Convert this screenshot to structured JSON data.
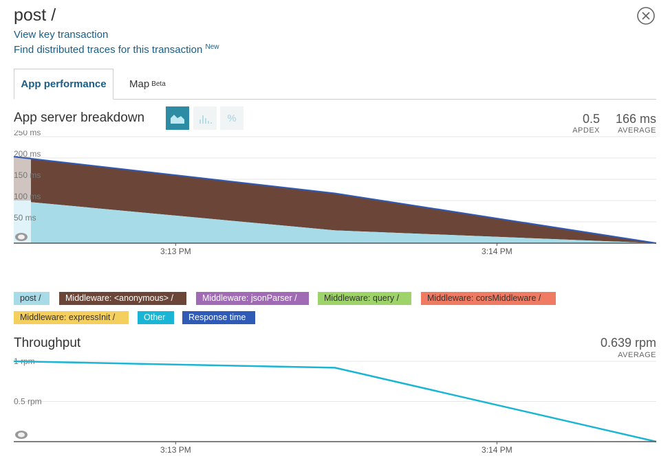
{
  "header": {
    "title": "post /",
    "view_key_transaction": "View key transaction",
    "find_traces": "Find distributed traces for this transaction",
    "find_traces_badge": "New"
  },
  "tabs": [
    {
      "label": "App performance",
      "badge": "",
      "active": true
    },
    {
      "label": "Map",
      "badge": "Beta",
      "active": false
    }
  ],
  "breakdown": {
    "title": "App server breakdown",
    "view_buttons": [
      "area-chart-icon",
      "histogram-icon",
      "percent-icon"
    ],
    "percent_symbol": "%",
    "apdex_value": "0.5",
    "apdex_label": "APDEX",
    "average_value": "166 ms",
    "average_label": "AVERAGE"
  },
  "throughput": {
    "title": "Throughput",
    "average_value": "0.639 rpm",
    "average_label": "AVERAGE"
  },
  "legend": [
    {
      "label": "post /",
      "color": "#a8dbe8",
      "text_color": "#333"
    },
    {
      "label": "Middleware: <anonymous> /",
      "color": "#6b4638",
      "text_color": "#fff"
    },
    {
      "label": "Middleware: jsonParser /",
      "color": "#a06ab4",
      "text_color": "#fff"
    },
    {
      "label": "Middleware: query /",
      "color": "#9ed36a",
      "text_color": "#333"
    },
    {
      "label": "Middleware: corsMiddleware /",
      "color": "#ee7b62",
      "text_color": "#333"
    },
    {
      "label": "Middleware: expressInit /",
      "color": "#f5cf5e",
      "text_color": "#333"
    },
    {
      "label": "Other",
      "color": "#1ab5d4",
      "text_color": "#fff"
    },
    {
      "label": "Response time",
      "color": "#2f5ab5",
      "text_color": "#fff"
    }
  ],
  "chart_data": [
    {
      "type": "area",
      "title": "App server breakdown",
      "x_ticks": [
        "3:13 PM",
        "3:14 PM"
      ],
      "y_ticks": [
        "250 ms",
        "200 ms",
        "150 ms",
        "100 ms",
        "50 ms"
      ],
      "ylim": [
        0,
        250
      ],
      "x": [
        0,
        0.5,
        1
      ],
      "series": [
        {
          "name": "post /",
          "values": [
            100,
            30,
            0
          ],
          "color": "#a8dbe8"
        },
        {
          "name": "Middleware: <anonymous> /",
          "values": [
            103,
            87,
            0
          ],
          "color": "#6b4638"
        },
        {
          "name": "Response time",
          "values": [
            203,
            117,
            0
          ],
          "color": "#2f5ab5"
        }
      ]
    },
    {
      "type": "line",
      "title": "Throughput",
      "x_ticks": [
        "3:13 PM",
        "3:14 PM"
      ],
      "y_ticks": [
        "1 rpm",
        "0.5 rpm"
      ],
      "ylim": [
        0,
        1
      ],
      "x": [
        0,
        0.5,
        1
      ],
      "series": [
        {
          "name": "Throughput",
          "values": [
            1,
            0.92,
            0
          ],
          "color": "#1ab5d4"
        }
      ]
    }
  ]
}
